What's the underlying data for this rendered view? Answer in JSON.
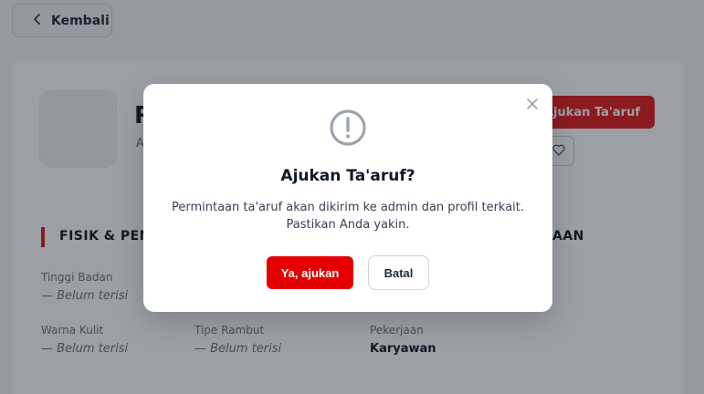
{
  "nav": {
    "back_label": "Kembali"
  },
  "profile": {
    "name_fragment": "R",
    "sub_fragment": "A"
  },
  "actions": {
    "ajukan_label": "Ajukan Ta'aruf"
  },
  "section_physical": {
    "title": "FISIK & PEN"
  },
  "section_right": {
    "title": "AAN"
  },
  "fields": [
    {
      "label": "Tinggi Badan",
      "value": "— Belum terisi"
    },
    {
      "label": "Warna Kulit",
      "value": "— Belum terisi"
    },
    {
      "label": "Tipe Rambut",
      "value": "— Belum terisi"
    },
    {
      "label": "Pekerjaan",
      "value": "Karyawan"
    }
  ],
  "modal": {
    "title": "Ajukan Ta'aruf?",
    "message_line1": "Permintaan ta'aruf akan dikirim ke admin dan profil terkait.",
    "message_line2": "Pastikan Anda yakin.",
    "confirm_label": "Ya, ajukan",
    "cancel_label": "Batal"
  },
  "icons": {
    "back": "chevron-left-icon",
    "heart": "heart-icon",
    "close": "close-icon",
    "alert": "exclamation-circle-icon"
  },
  "colors": {
    "accent": "#e40000",
    "overlay": "rgba(20,26,40,0.42)"
  }
}
